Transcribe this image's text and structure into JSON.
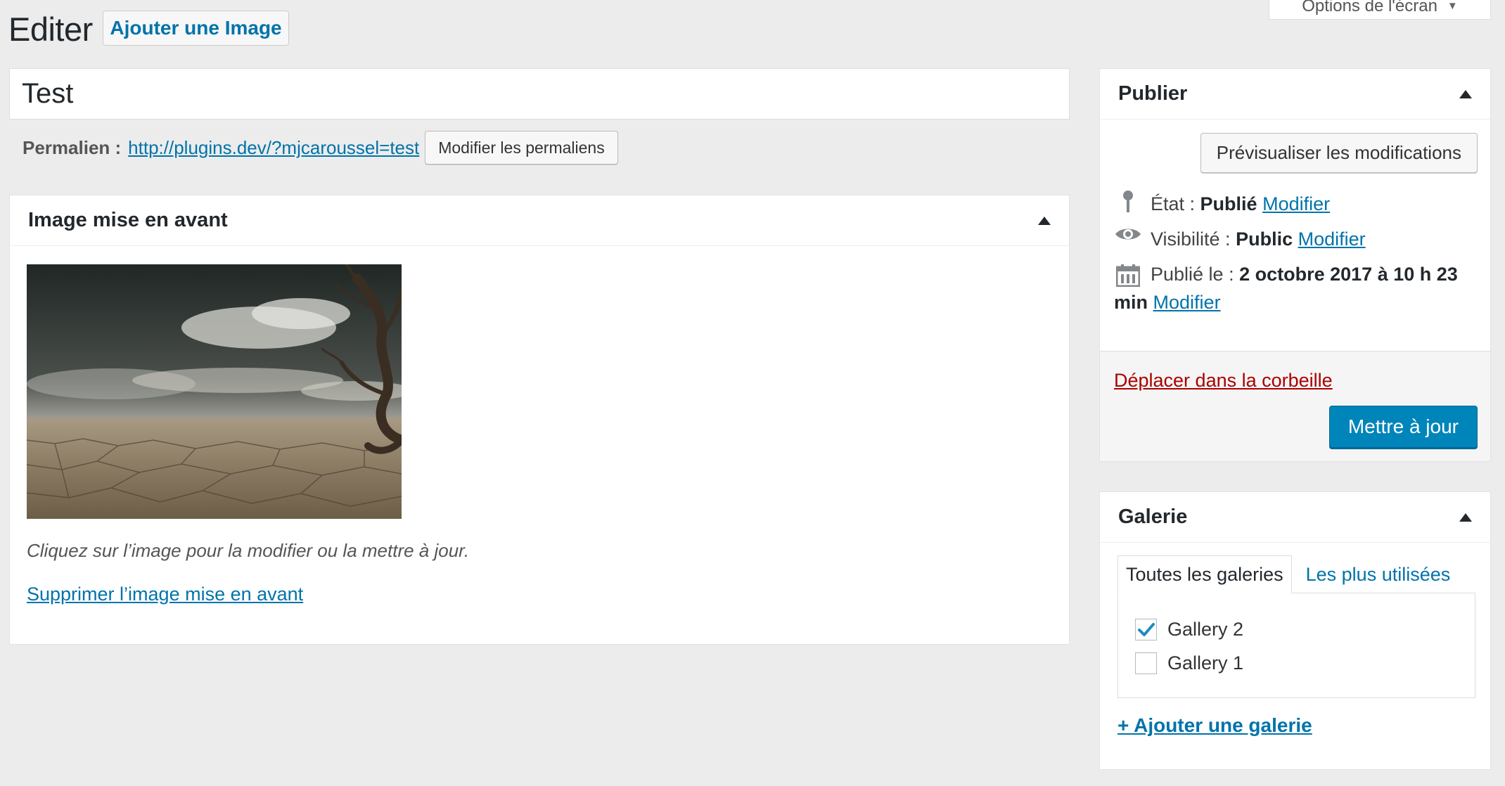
{
  "header": {
    "title": "Editer",
    "add_image_label": "Ajouter une Image",
    "screen_options_label": "Options de l'écran"
  },
  "post": {
    "title_value": "Test",
    "permalink_label": "Permalien :",
    "permalink_url": "http://plugins.dev/?mjcaroussel=test",
    "edit_permalink_label": "Modifier les permaliens"
  },
  "featured": {
    "title": "Image mise en avant",
    "hint": "Cliquez sur l’image pour la modifier ou la mettre à jour.",
    "remove_label": "Supprimer l’image mise en avant"
  },
  "publish": {
    "title": "Publier",
    "preview_label": "Prévisualiser les modifications",
    "status_label": "État :",
    "status_value": "Publié",
    "visibility_label": "Visibilité :",
    "visibility_value": "Public",
    "published_label": "Publié le :",
    "published_value": "2 octobre 2017 à 10 h 23",
    "published_value_cont": "min",
    "edit_label": "Modifier",
    "trash_label": "Déplacer dans la corbeille",
    "update_label": "Mettre à jour"
  },
  "gallery": {
    "title": "Galerie",
    "tab_all": "Toutes les galeries",
    "tab_popular": "Les plus utilisées",
    "items": [
      {
        "label": "Gallery 2",
        "checked": true
      },
      {
        "label": "Gallery 1",
        "checked": false
      }
    ],
    "add_label": "+ Ajouter une galerie"
  },
  "colors": {
    "link": "#0073aa",
    "primary_button": "#0085ba",
    "trash": "#aa0000",
    "background": "#ececec"
  }
}
